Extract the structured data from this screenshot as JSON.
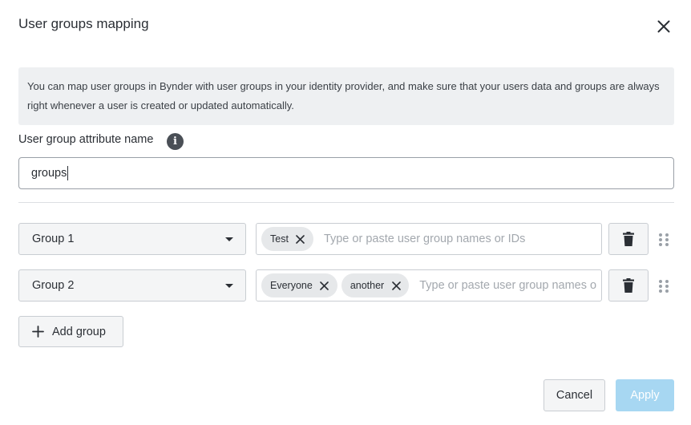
{
  "dialog": {
    "title": "User groups mapping",
    "close_icon": "close-icon",
    "info_text": "You can map user groups in Bynder with user groups in your identity provider, and make sure that your users data and groups are always right whenever a user is created or updated automatically.",
    "attribute_label": "User group attribute name",
    "attribute_info_icon": "info-icon",
    "attribute_value": "groups"
  },
  "mappings": [
    {
      "group": "Group 1",
      "tags": [
        "Test"
      ],
      "placeholder": "Type or paste user group names or IDs"
    },
    {
      "group": "Group 2",
      "tags": [
        "Everyone",
        "another"
      ],
      "placeholder": "Type or paste user group names or IDs"
    }
  ],
  "icons": {
    "select": "chevron-down-icon",
    "remove_tag": "close-icon",
    "delete": "trash-icon",
    "drag": "drag-handle-icon",
    "add": "plus-icon"
  },
  "actions": {
    "add_group": "Add group",
    "cancel": "Cancel",
    "apply": "Apply"
  },
  "colors": {
    "apply_disabled": "#a7d7f2",
    "info_background": "#eef0f2"
  }
}
